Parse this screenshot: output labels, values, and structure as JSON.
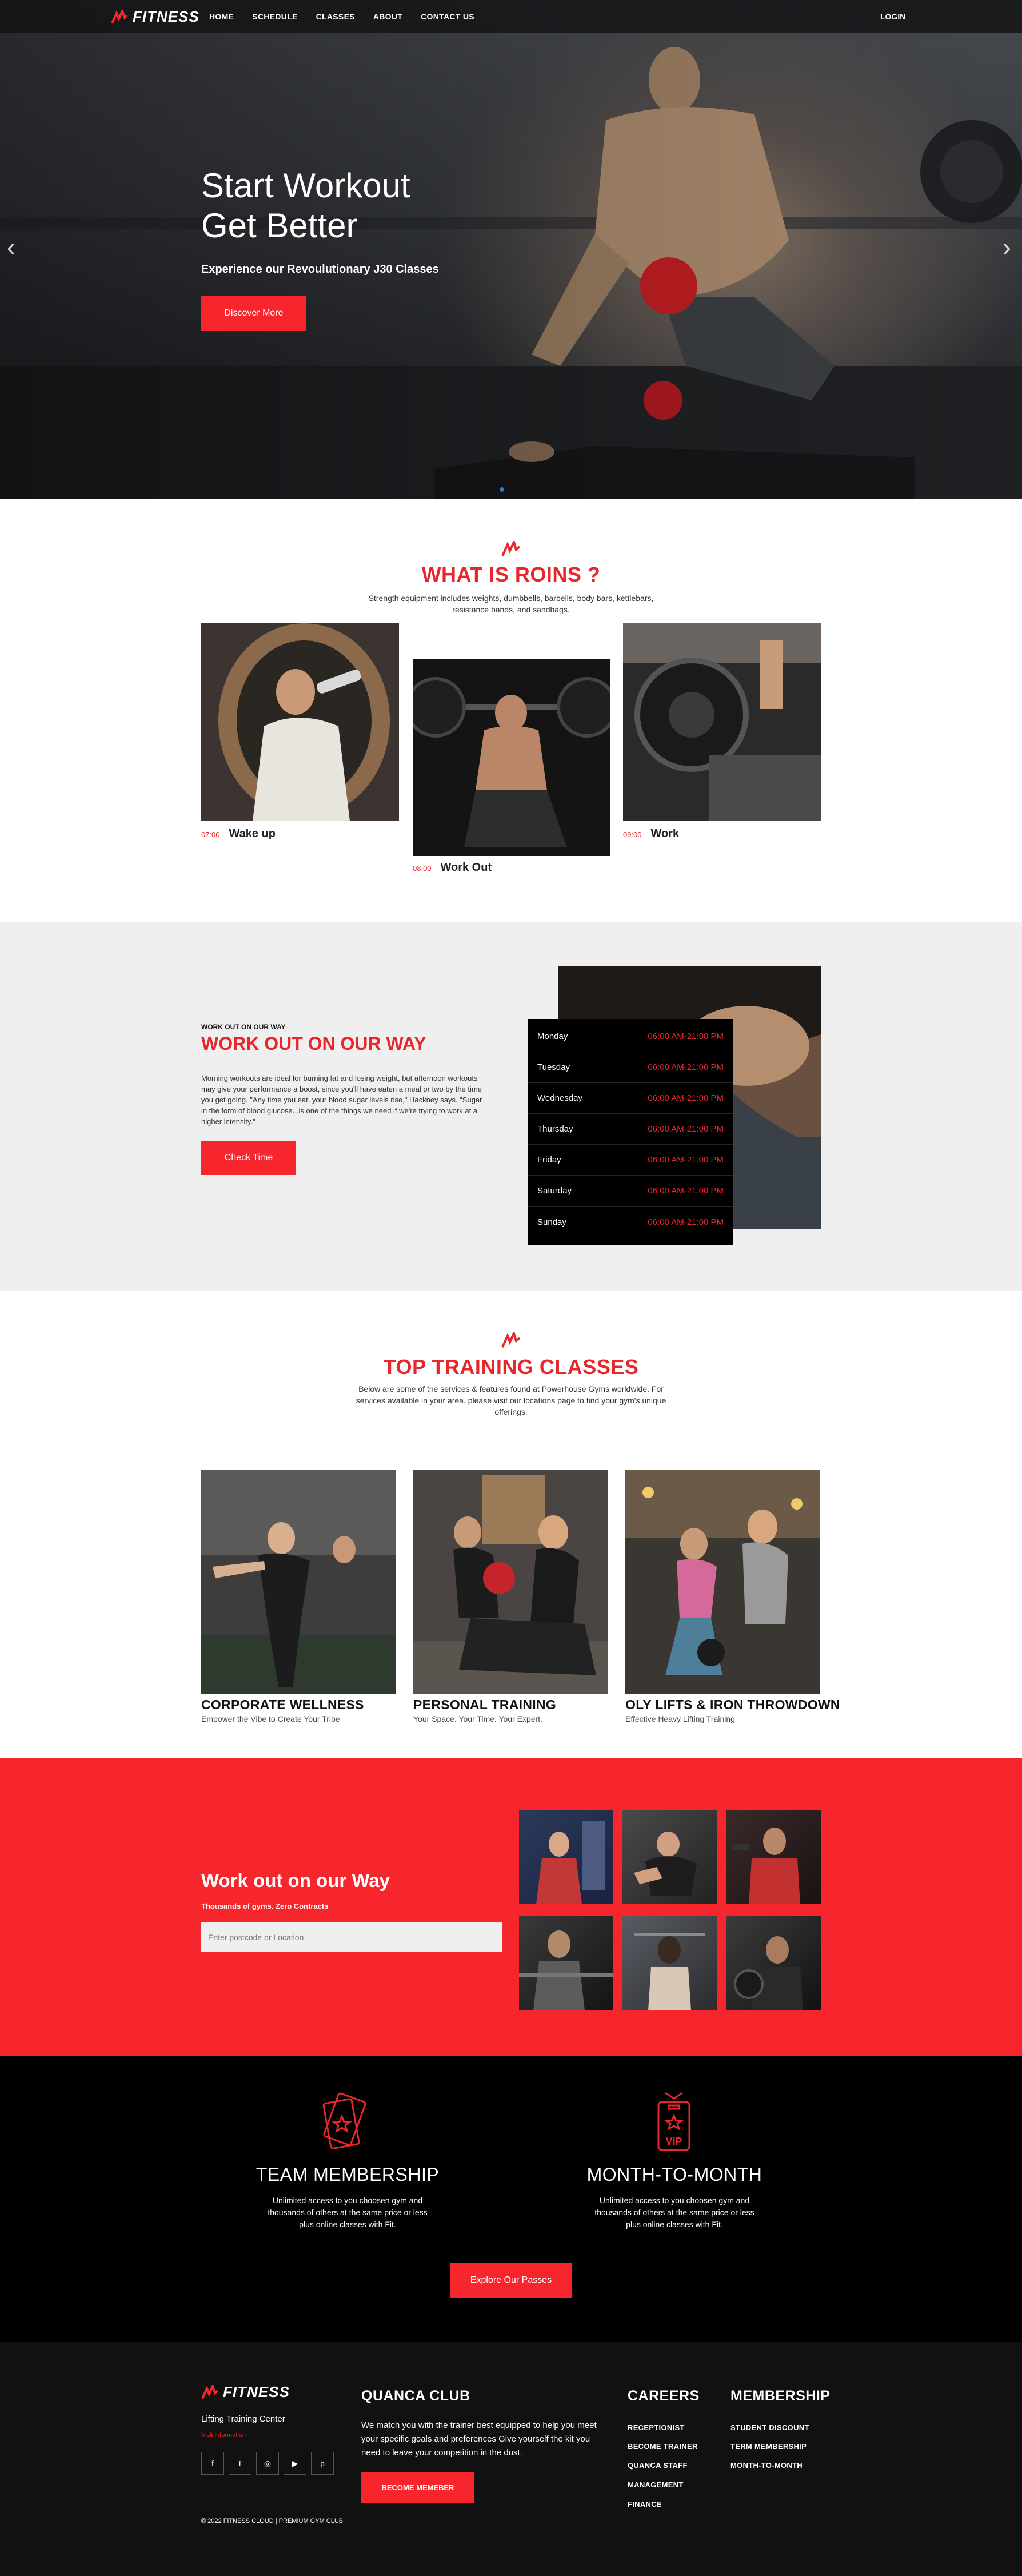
{
  "nav": {
    "logo": "FITNESS",
    "links": [
      "HOME",
      "SCHEDULE",
      "CLASSES",
      "ABOUT",
      "CONTACT US"
    ],
    "login": "LOGIN"
  },
  "hero": {
    "title_line1": "Start Workout",
    "title_line2": "Get Better",
    "subtitle": "Experience our Revoulutionary J30 Classes",
    "cta": "Discover More",
    "prev": "‹",
    "next": "›"
  },
  "about": {
    "title": "WHAT IS ROINS ?",
    "desc_line1": "Strength equipment includes weights, dumbbells, barbells, body bars, kettlebars,",
    "desc_line2": "resistance bands, and sandbags.",
    "items": [
      {
        "time": "07:00 -",
        "title": "Wake up"
      },
      {
        "time": "08:00 -",
        "title": "Work Out"
      },
      {
        "time": "09:00 -",
        "title": "Work"
      }
    ]
  },
  "schedule": {
    "eyebrow": "WORK OUT ON OUR WAY",
    "title": "WORK OUT ON OUR WAY",
    "paragraph": [
      "Morning workouts are ideal for burning fat and losing weight, but afternoon workouts",
      "may give your performance a boost, since you'll have eaten a meal or two by the time",
      "you get going. \"Any time you eat, your blood sugar levels rise,\" Hackney says. \"Sugar",
      "in the form of blood glucose...is one of the things we need if we're trying to work at a",
      "higher intensity.\""
    ],
    "cta": "Check Time",
    "days": [
      {
        "day": "Monday",
        "hours": "06:00 AM-21:00 PM"
      },
      {
        "day": "Tuesday",
        "hours": "06:00 AM-21:00 PM"
      },
      {
        "day": "Wednesday",
        "hours": "06:00 AM-21:00 PM"
      },
      {
        "day": "Thursday",
        "hours": "06:00 AM-21:00 PM"
      },
      {
        "day": "Friday",
        "hours": "06:00 AM-21:00 PM"
      },
      {
        "day": "Saturday",
        "hours": "06:00 AM-21:00 PM"
      },
      {
        "day": "Sunday",
        "hours": "06:00 AM-21:00 PM"
      }
    ]
  },
  "classes": {
    "title": "TOP TRAINING CLASSES",
    "desc": [
      "Below are some of the services & features found at Powerhouse Gyms worldwide. For",
      "services available in your area, please visit our locations page to find your gym's unique",
      "offerings."
    ],
    "cards": [
      {
        "title": "CORPORATE WELLNESS",
        "sub": "Empower the Vibe to Create Your Tribe"
      },
      {
        "title": "PERSONAL TRAINING",
        "sub": "Your Space. Your Time. Your Expert."
      },
      {
        "title": "OLY LIFTS & IRON THROWDOWN",
        "sub": "Effective Heavy Lifting Training"
      }
    ]
  },
  "locate": {
    "title": "Work out on our Way",
    "sub": "Thousands of gyms. Zero Contracts",
    "placeholder": "Enter postcode or Location"
  },
  "membership": {
    "plans": [
      {
        "title": "TEAM MEMBERSHIP",
        "desc": [
          "Unlimited access to you choosen gym and",
          "thousands of others at the same price or less",
          "plus online classes with Fit."
        ]
      },
      {
        "title": "MONTH-TO-MONTH",
        "desc": [
          "Unlimited access to you choosen gym and",
          "thousands of others at the same price or less",
          "plus online classes with Fit."
        ]
      }
    ],
    "vip": "VIP",
    "cta": "Explore Our Passes"
  },
  "footer": {
    "logo": "FITNESS",
    "tagline": "Lifting Training Center",
    "info_label": "Visit information",
    "social": [
      "f",
      "t",
      "◎",
      "▶",
      "p"
    ],
    "club_title": "QUANCA CLUB",
    "club_desc": [
      "We match you with the trainer best equipped to help you meet",
      "your specific goals and preferences Give yourself the kit you",
      "need to leave your competition in the dust."
    ],
    "club_cta": "BECOME MEMEBER",
    "careers_title": "CAREERS",
    "careers": [
      "RECEPTIONIST",
      "BECOME TRAINER",
      "QUANCA STAFF",
      "MANAGEMENT",
      "FINANCE"
    ],
    "membership_title": "MEMBERSHIP",
    "membership_links": [
      "STUDENT DISCOUNT",
      "TERM MEMBERSHIP",
      "MONTH-TO-MONTH"
    ],
    "copyright": "© 2022 FITNESS CLOUD | PREMIUM GYM CLUB"
  },
  "colors": {
    "accent": "#f6262c",
    "title_red": "#e8262b",
    "dark": "#000000",
    "grey_bg": "#efefef"
  }
}
